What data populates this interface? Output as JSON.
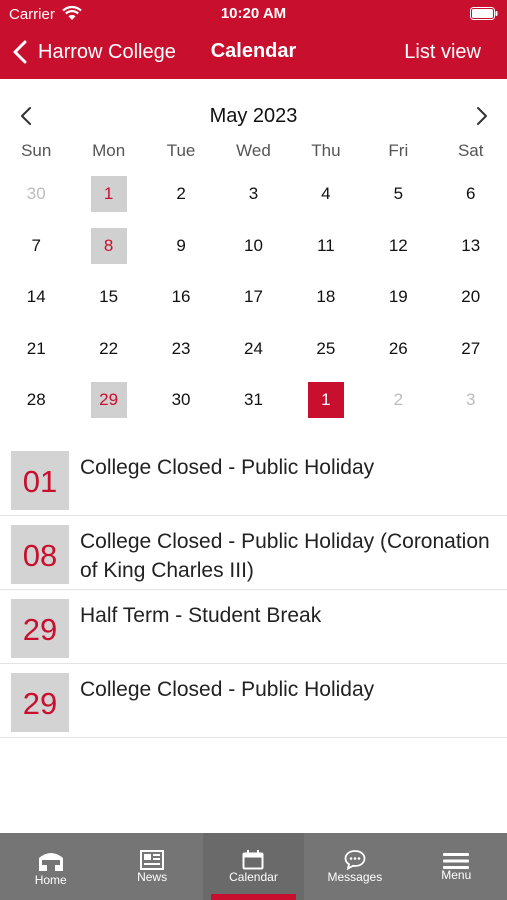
{
  "status_bar": {
    "carrier": "Carrier",
    "time": "10:20 AM"
  },
  "nav": {
    "back_label": "Harrow College",
    "title": "Calendar",
    "list_view_label": "List view"
  },
  "calendar": {
    "month_label": "May 2023",
    "weekdays": [
      "Sun",
      "Mon",
      "Tue",
      "Wed",
      "Thu",
      "Fri",
      "Sat"
    ],
    "weeks": [
      [
        {
          "day": "30",
          "muted": true
        },
        {
          "day": "1",
          "event": true
        },
        {
          "day": "2"
        },
        {
          "day": "3"
        },
        {
          "day": "4"
        },
        {
          "day": "5"
        },
        {
          "day": "6"
        }
      ],
      [
        {
          "day": "7"
        },
        {
          "day": "8",
          "event": true
        },
        {
          "day": "9"
        },
        {
          "day": "10"
        },
        {
          "day": "11"
        },
        {
          "day": "12"
        },
        {
          "day": "13"
        }
      ],
      [
        {
          "day": "14"
        },
        {
          "day": "15"
        },
        {
          "day": "16"
        },
        {
          "day": "17"
        },
        {
          "day": "18"
        },
        {
          "day": "19"
        },
        {
          "day": "20"
        }
      ],
      [
        {
          "day": "21"
        },
        {
          "day": "22"
        },
        {
          "day": "23"
        },
        {
          "day": "24"
        },
        {
          "day": "25"
        },
        {
          "day": "26"
        },
        {
          "day": "27"
        }
      ],
      [
        {
          "day": "28"
        },
        {
          "day": "29",
          "event": true
        },
        {
          "day": "30"
        },
        {
          "day": "31"
        },
        {
          "day": "1",
          "selected": true
        },
        {
          "day": "2",
          "muted": true
        },
        {
          "day": "3",
          "muted": true
        }
      ]
    ]
  },
  "events": [
    {
      "date": "01",
      "title": "College Closed - Public Holiday"
    },
    {
      "date": "08",
      "title": "College Closed - Public Holiday (Coronation of King Charles III)"
    },
    {
      "date": "29",
      "title": "Half Term - Student Break"
    },
    {
      "date": "29",
      "title": "College Closed - Public Holiday"
    }
  ],
  "tabs": [
    {
      "label": "Home",
      "icon": "home-icon"
    },
    {
      "label": "News",
      "icon": "news-icon"
    },
    {
      "label": "Calendar",
      "icon": "calendar-icon",
      "active": true
    },
    {
      "label": "Messages",
      "icon": "messages-icon"
    },
    {
      "label": "Menu",
      "icon": "menu-icon"
    }
  ],
  "colors": {
    "brand": "#c8102e",
    "tab_bar": "#757575",
    "event_marker": "#d0d0d0"
  }
}
